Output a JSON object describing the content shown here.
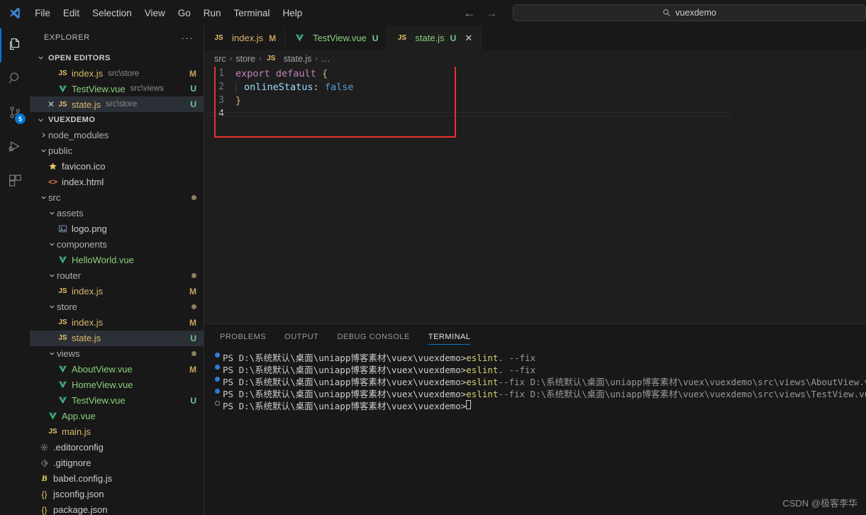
{
  "titlebar": {
    "menus": [
      "File",
      "Edit",
      "Selection",
      "View",
      "Go",
      "Run",
      "Terminal",
      "Help"
    ],
    "nav_back": "←",
    "nav_forward": "→",
    "search_value": "vuexdemo"
  },
  "activitybar": {
    "items": [
      {
        "name": "explorer",
        "active": true
      },
      {
        "name": "search",
        "active": false
      },
      {
        "name": "source-control",
        "active": false,
        "badge": "5"
      },
      {
        "name": "run-debug",
        "active": false
      },
      {
        "name": "extensions",
        "active": false
      }
    ]
  },
  "sidebar": {
    "title": "EXPLORER",
    "more_label": "···",
    "open_editors": {
      "label": "OPEN EDITORS",
      "items": [
        {
          "name": "index.js",
          "dir": "src\\store",
          "mark": "M",
          "mark_type": "m",
          "icon": "js",
          "selected": false,
          "close": false
        },
        {
          "name": "TestView.vue",
          "dir": "src\\views",
          "mark": "U",
          "mark_type": "u",
          "icon": "vue",
          "selected": false,
          "close": false
        },
        {
          "name": "state.js",
          "dir": "src\\store",
          "mark": "U",
          "mark_type": "u",
          "icon": "js",
          "selected": true,
          "close": true
        }
      ]
    },
    "project": {
      "label": "VUEXDEMO",
      "tree": [
        {
          "name": "node_modules",
          "type": "folder",
          "collapsed": true,
          "indent": 1
        },
        {
          "name": "public",
          "type": "folder",
          "collapsed": false,
          "indent": 1
        },
        {
          "name": "favicon.ico",
          "type": "file",
          "icon": "star",
          "indent": 2
        },
        {
          "name": "index.html",
          "type": "file",
          "icon": "html",
          "indent": 2
        },
        {
          "name": "src",
          "type": "folder",
          "collapsed": false,
          "indent": 1,
          "dot": true
        },
        {
          "name": "assets",
          "type": "folder",
          "collapsed": false,
          "indent": 2
        },
        {
          "name": "logo.png",
          "type": "file",
          "icon": "image",
          "indent": 3
        },
        {
          "name": "components",
          "type": "folder",
          "collapsed": false,
          "indent": 2
        },
        {
          "name": "HelloWorld.vue",
          "type": "file",
          "icon": "vue",
          "indent": 3
        },
        {
          "name": "router",
          "type": "folder",
          "collapsed": false,
          "indent": 2,
          "dot": true
        },
        {
          "name": "index.js",
          "type": "file",
          "icon": "js",
          "indent": 3,
          "mark": "M",
          "mark_type": "m"
        },
        {
          "name": "store",
          "type": "folder",
          "collapsed": false,
          "indent": 2,
          "dot": true
        },
        {
          "name": "index.js",
          "type": "file",
          "icon": "js",
          "indent": 3,
          "mark": "M",
          "mark_type": "m"
        },
        {
          "name": "state.js",
          "type": "file",
          "icon": "js",
          "indent": 3,
          "mark": "U",
          "mark_type": "u",
          "selected": true
        },
        {
          "name": "views",
          "type": "folder",
          "collapsed": false,
          "indent": 2,
          "dot": true
        },
        {
          "name": "AboutView.vue",
          "type": "file",
          "icon": "vue",
          "indent": 3,
          "mark": "M",
          "mark_type": "m"
        },
        {
          "name": "HomeView.vue",
          "type": "file",
          "icon": "vue",
          "indent": 3
        },
        {
          "name": "TestView.vue",
          "type": "file",
          "icon": "vue",
          "indent": 3,
          "mark": "U",
          "mark_type": "u"
        },
        {
          "name": "App.vue",
          "type": "file",
          "icon": "vue",
          "indent": 2
        },
        {
          "name": "main.js",
          "type": "file",
          "icon": "js",
          "indent": 2
        },
        {
          "name": ".editorconfig",
          "type": "file",
          "icon": "gear",
          "indent": 1
        },
        {
          "name": ".gitignore",
          "type": "file",
          "icon": "git",
          "indent": 1
        },
        {
          "name": "babel.config.js",
          "type": "file",
          "icon": "babel",
          "indent": 1
        },
        {
          "name": "jsconfig.json",
          "type": "file",
          "icon": "json",
          "indent": 1
        },
        {
          "name": "package.json",
          "type": "file",
          "icon": "json",
          "indent": 1
        }
      ]
    }
  },
  "editor": {
    "tabs": [
      {
        "name": "index.js",
        "icon": "js",
        "mark": "M",
        "mark_type": "m",
        "active": false,
        "close": false
      },
      {
        "name": "TestView.vue",
        "icon": "vue",
        "mark": "U",
        "mark_type": "u",
        "active": false,
        "close": false
      },
      {
        "name": "state.js",
        "icon": "js",
        "mark": "U",
        "mark_type": "u",
        "active": true,
        "close": true
      }
    ],
    "close_glyph": "✕",
    "breadcrumb": [
      "src",
      "store",
      "state.js",
      "…"
    ],
    "breadcrumb_sep": "›",
    "lines": [
      {
        "num": "1",
        "tokens": [
          {
            "t": "export",
            "c": "kw"
          },
          {
            "t": " ",
            "c": "punc"
          },
          {
            "t": "default",
            "c": "kw"
          },
          {
            "t": " ",
            "c": "punc"
          },
          {
            "t": "{",
            "c": "brace"
          }
        ]
      },
      {
        "num": "2",
        "indent_guide": true,
        "tokens": [
          {
            "t": "onlineStatus",
            "c": "prop"
          },
          {
            "t": ": ",
            "c": "punc"
          },
          {
            "t": "false",
            "c": "bool"
          }
        ]
      },
      {
        "num": "3",
        "tokens": [
          {
            "t": "}",
            "c": "brace"
          }
        ]
      },
      {
        "num": "4",
        "current": true,
        "tokens": []
      }
    ]
  },
  "panel": {
    "tabs": [
      "PROBLEMS",
      "OUTPUT",
      "DEBUG CONSOLE",
      "TERMINAL"
    ],
    "active_tab": "TERMINAL",
    "terminal_lines": [
      {
        "bullet": "filled",
        "prompt": "PS D:\\系统默认\\桌面\\uniapp博客素材\\vuex\\vuexdemo>",
        "cmd": "eslint",
        "args": ". --fix"
      },
      {
        "bullet": "filled",
        "prompt": "PS D:\\系统默认\\桌面\\uniapp博客素材\\vuex\\vuexdemo>",
        "cmd": "eslint",
        "args": ". --fix"
      },
      {
        "bullet": "filled",
        "prompt": "PS D:\\系统默认\\桌面\\uniapp博客素材\\vuex\\vuexdemo>",
        "cmd": "eslint",
        "args": "--fix D:\\系统默认\\桌面\\uniapp博客素材\\vuex\\vuexdemo\\src\\views\\AboutView.vue"
      },
      {
        "bullet": "filled",
        "prompt": "PS D:\\系统默认\\桌面\\uniapp博客素材\\vuex\\vuexdemo>",
        "cmd": "eslint",
        "args": "--fix D:\\系统默认\\桌面\\uniapp博客素材\\vuex\\vuexdemo\\src\\views\\TestView.vue"
      },
      {
        "bullet": "hollow",
        "prompt": "PS D:\\系统默认\\桌面\\uniapp博客素材\\vuex\\vuexdemo>",
        "cmd": "",
        "args": "",
        "cursor": true
      }
    ]
  },
  "watermark": "CSDN @极客李华",
  "colors": {
    "accent": "#0078d4",
    "annotation": "#e8312a",
    "modified": "#c6a25d",
    "untracked": "#73c991"
  }
}
